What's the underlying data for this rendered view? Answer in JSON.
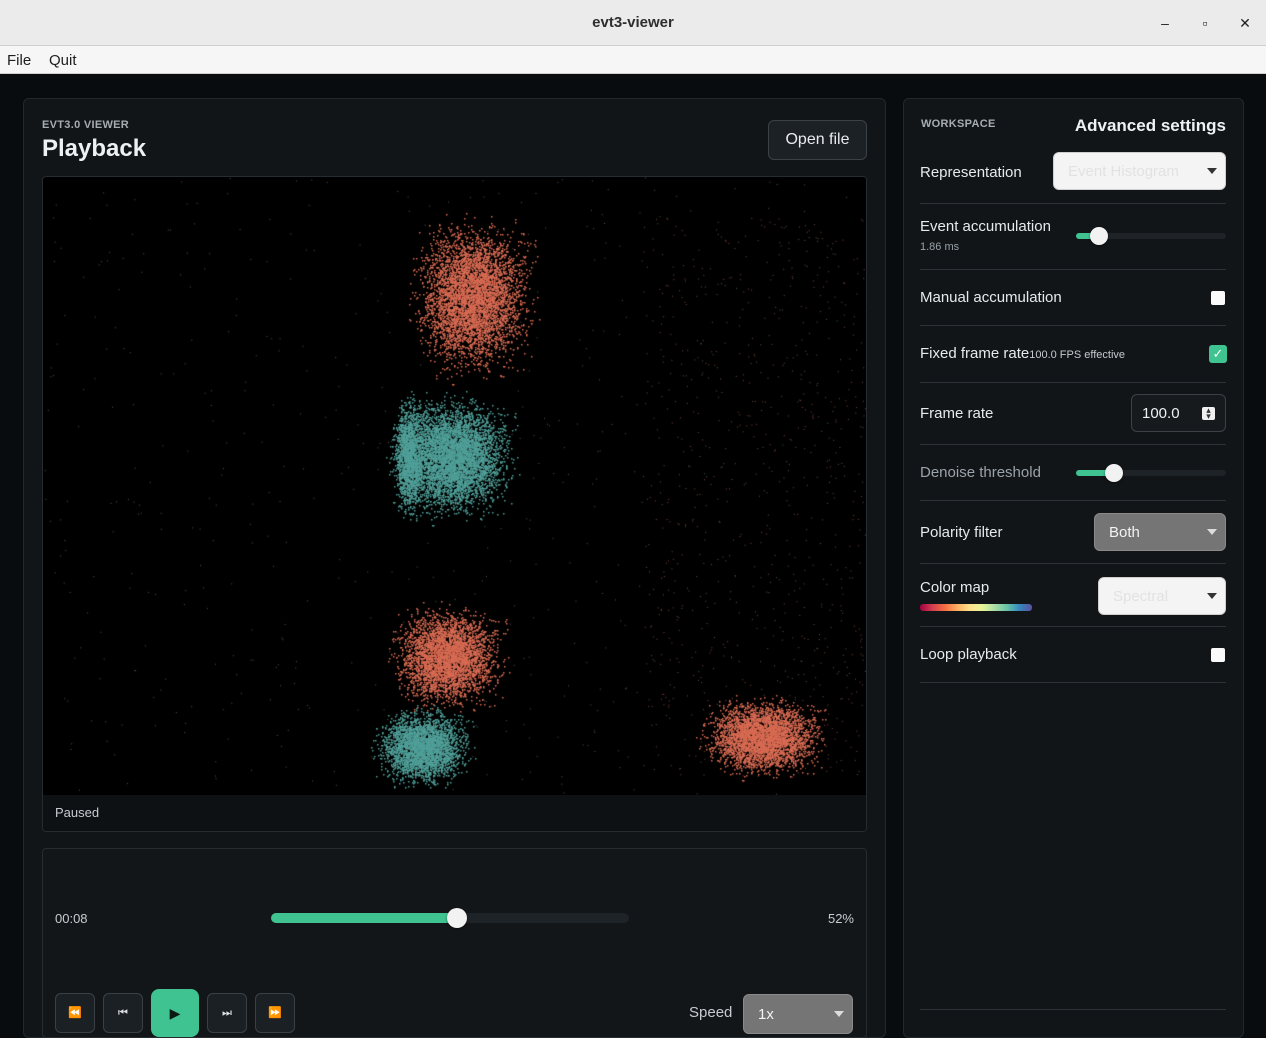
{
  "window": {
    "title": "evt3-viewer",
    "minimize": "–",
    "maximize": "▫",
    "close": "✕"
  },
  "menu": {
    "file": "File",
    "quit": "Quit"
  },
  "playback": {
    "kicker": "EVT3.0 VIEWER",
    "title": "Playback",
    "open_file": "Open file",
    "status": "Paused",
    "time": "00:08",
    "progress_label": "52%",
    "progress": 0.52,
    "speed_label": "Speed",
    "speed_value": "1x",
    "buttons": {
      "rewind": "⏪",
      "prev": "⏮",
      "play": "▶",
      "next": "⏭",
      "forward": "⏩"
    }
  },
  "settings": {
    "kicker": "WORKSPACE",
    "title": "Advanced settings",
    "representation": {
      "label": "Representation",
      "value": "Event Histogram"
    },
    "event_accumulation": {
      "label": "Event accumulation",
      "value": "1.86 ms",
      "level": 0.15
    },
    "manual_accumulation": {
      "label": "Manual accumulation",
      "checked": false
    },
    "fixed_frame_rate": {
      "label": "Fixed frame rate",
      "note": "100.0 FPS effective",
      "checked": true
    },
    "frame_rate": {
      "label": "Frame rate",
      "value": "100.0"
    },
    "denoise_threshold": {
      "label": "Denoise threshold",
      "level": 0.25
    },
    "polarity_filter": {
      "label": "Polarity filter",
      "value": "Both"
    },
    "color_map": {
      "label": "Color map",
      "value": "Spectral"
    },
    "loop_playback": {
      "label": "Loop playback",
      "checked": false
    }
  },
  "colors": {
    "accent": "#3ec391",
    "positive": "#d86a52",
    "negative": "#4f9e97",
    "bg": "#090c0e"
  }
}
